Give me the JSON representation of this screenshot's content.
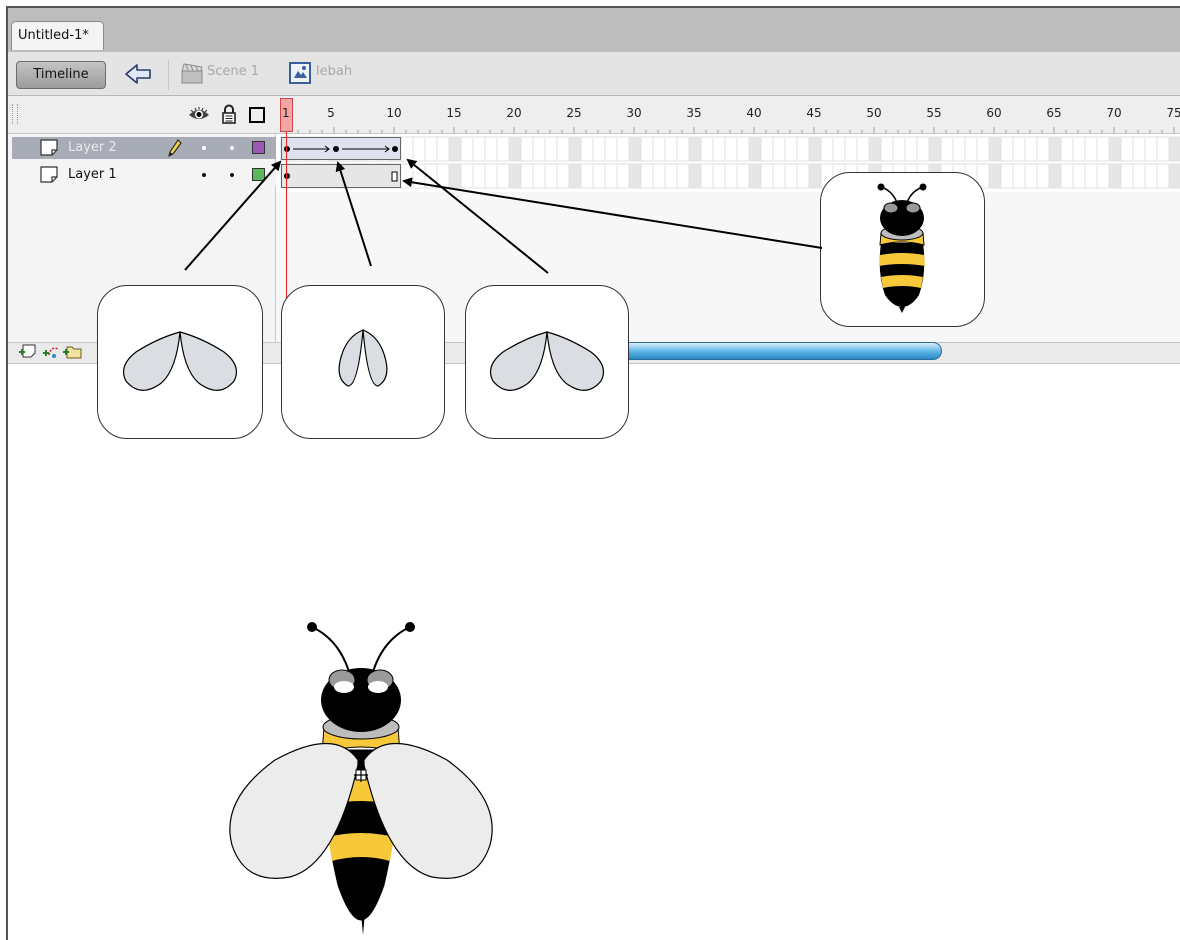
{
  "document": {
    "tab_title": "Untitled-1*"
  },
  "editbar": {
    "timeline_label": "Timeline",
    "scene_label": "Scene 1",
    "symbol_label": "lebah"
  },
  "timeline": {
    "current_frame": "1",
    "ruler_labels": [
      "5",
      "10",
      "15",
      "20",
      "25",
      "30",
      "35",
      "40",
      "45",
      "50",
      "55",
      "60",
      "65",
      "70",
      "75"
    ],
    "layers": [
      {
        "name": "Layer 2",
        "selected": true,
        "color": "#9b59b6"
      },
      {
        "name": "Layer 1",
        "selected": false,
        "color": "#5cb85c"
      }
    ]
  },
  "colors": {
    "playhead": "#ee2222",
    "scroll_accent": "#3a9ad8",
    "bee_yellow": "#f7c93a"
  },
  "icons": [
    "eye-icon",
    "lock-icon",
    "outline-icon",
    "pencil-icon",
    "back-arrow-icon",
    "scene-icon",
    "symbol-icon",
    "add-layer-icon",
    "add-motion-guide-icon",
    "add-folder-icon"
  ]
}
